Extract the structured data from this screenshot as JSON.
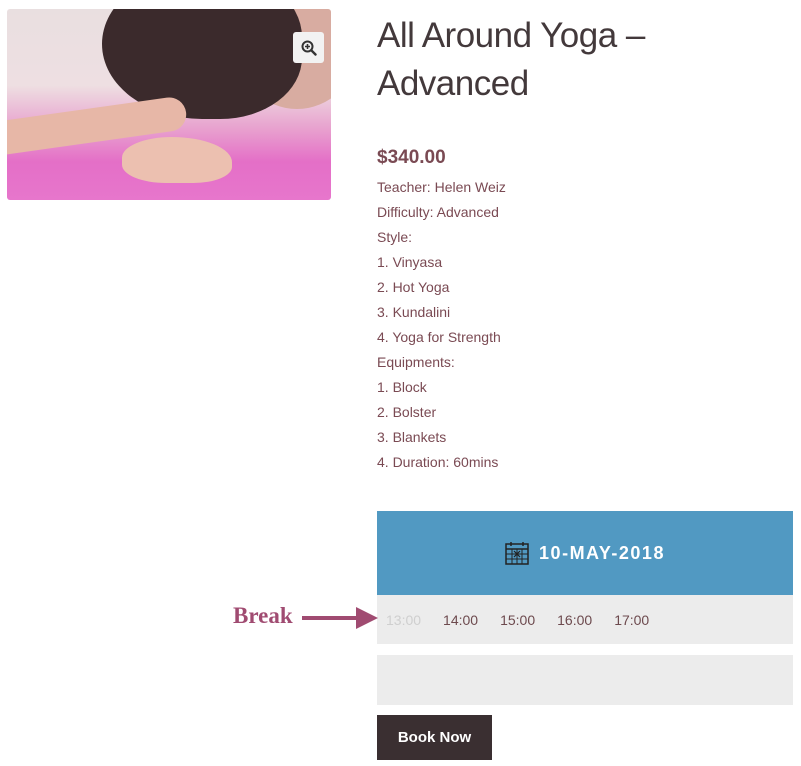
{
  "product": {
    "title_line1": "All Around Yoga –",
    "title_line2": "Advanced",
    "price": "$340.00",
    "description": [
      "Teacher: Helen Weiz",
      "Difficulty: Advanced",
      "Style:",
      "1. Vinyasa",
      "2. Hot Yoga",
      "3. Kundalini",
      "4. Yoga for Strength",
      "Equipments:",
      "1. Block",
      "2. Bolster",
      "3. Blankets",
      "4. Duration: 60mins"
    ]
  },
  "image": {
    "zoom_icon": "zoom-in-icon"
  },
  "booking": {
    "calendar_icon": "calendar-icon",
    "date": "10-MAY-2018",
    "slots": [
      {
        "time": "13:00",
        "available": false
      },
      {
        "time": "14:00",
        "available": true
      },
      {
        "time": "15:00",
        "available": true
      },
      {
        "time": "16:00",
        "available": true
      },
      {
        "time": "17:00",
        "available": true
      }
    ],
    "book_label": "Book Now"
  },
  "annotation": {
    "label": "Break"
  },
  "colors": {
    "accent": "#5199c2",
    "button": "#3a2f31",
    "text": "#7a4a53",
    "annotation": "#a04b71"
  }
}
